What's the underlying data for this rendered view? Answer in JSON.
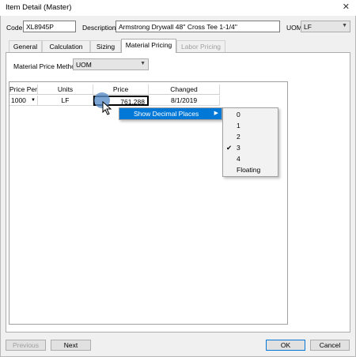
{
  "window": {
    "title": "Item Detail (Master)",
    "close_glyph": "✕"
  },
  "code": {
    "label": "Code",
    "value": "XL8945P"
  },
  "description": {
    "label": "Description",
    "value": "Armstrong Drywall 48'' Cross Tee 1-1/4''"
  },
  "uom": {
    "label": "UOM",
    "value": "LF"
  },
  "tabs": [
    {
      "label": "General"
    },
    {
      "label": "Calculation"
    },
    {
      "label": "Sizing"
    },
    {
      "label": "Material Pricing"
    },
    {
      "label": "Labor Pricing"
    }
  ],
  "price_method": {
    "label": "Material Price Method",
    "value": "UOM"
  },
  "grid": {
    "columns": [
      "Price Per",
      "Units",
      "Price",
      "Changed"
    ],
    "row": {
      "price_per": "1000",
      "units": "LF",
      "price": "761.288",
      "changed": "8/1/2019"
    }
  },
  "context_menu": {
    "item": "Show Decimal Places"
  },
  "submenu": {
    "items": [
      "0",
      "1",
      "2",
      "3",
      "4",
      "Floating"
    ],
    "checked": "3",
    "check_glyph": "✔"
  },
  "buttons": {
    "previous": "Previous",
    "next": "Next",
    "ok": "OK",
    "cancel": "Cancel"
  },
  "colors": {
    "selection": "#0078d7",
    "cursor_highlight": "#5b8ec9"
  }
}
